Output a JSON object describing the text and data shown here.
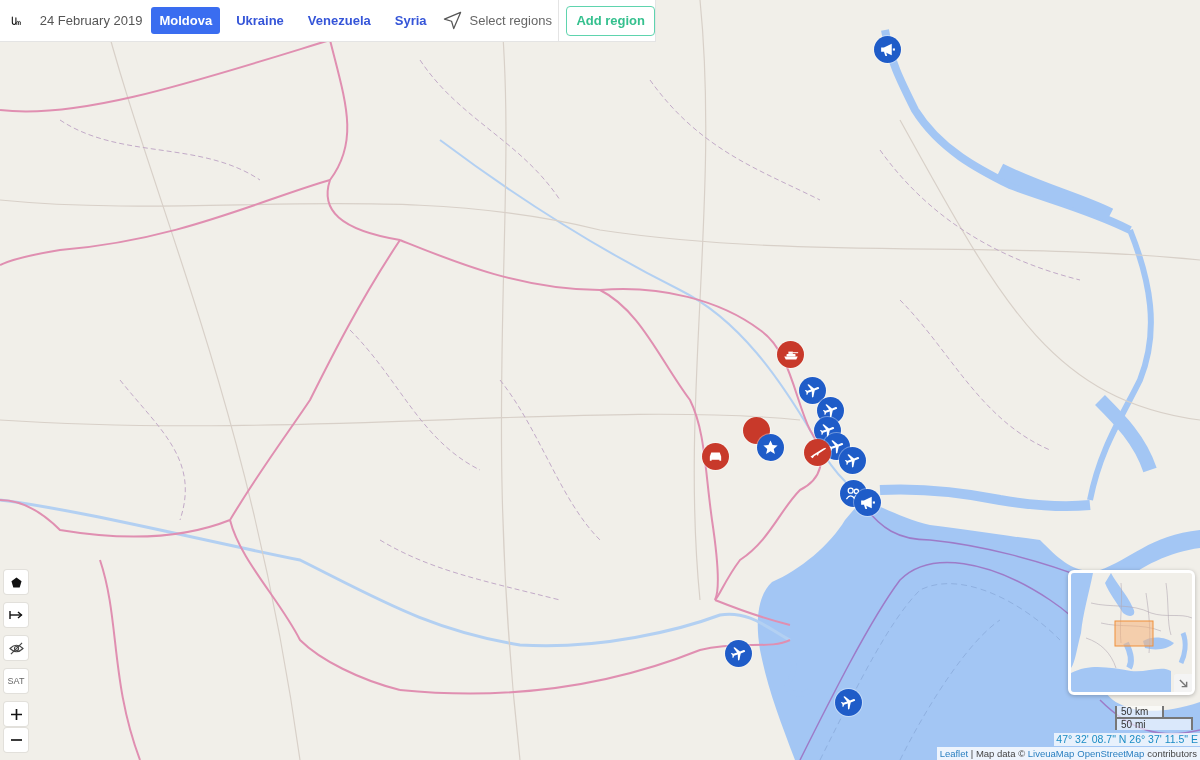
{
  "top_bar": {
    "date": "24 February 2019",
    "tabs": [
      {
        "label": "Moldova",
        "selected": true
      },
      {
        "label": "Ukraine",
        "selected": false
      },
      {
        "label": "Venezuela",
        "selected": false
      },
      {
        "label": "Syria",
        "selected": false
      }
    ],
    "select_regions": "Select regions",
    "add_region_button": "Add region"
  },
  "map_controls": {
    "layer_button": "SAT"
  },
  "markers": [
    {
      "kind": "megaphone",
      "color": "#1f5cc8"
    },
    {
      "kind": "tank",
      "color": "#c8392a"
    },
    {
      "kind": "plane",
      "color": "#1f5cc8"
    },
    {
      "kind": "plane",
      "color": "#1f5cc8"
    },
    {
      "kind": "plain",
      "color": "#c8392a"
    },
    {
      "kind": "plane",
      "color": "#1f5cc8"
    },
    {
      "kind": "plane",
      "color": "#1f5cc8"
    },
    {
      "kind": "star",
      "color": "#1f5cc8"
    },
    {
      "kind": "rifle",
      "color": "#c8392a"
    },
    {
      "kind": "car",
      "color": "#c8392a"
    },
    {
      "kind": "plane",
      "color": "#1f5cc8"
    },
    {
      "kind": "people",
      "color": "#1f5cc8"
    },
    {
      "kind": "megaphone",
      "color": "#1f5cc8"
    },
    {
      "kind": "plane",
      "color": "#1f5cc8"
    },
    {
      "kind": "plane",
      "color": "#1f5cc8"
    }
  ],
  "scale": {
    "metric": "50 km",
    "imperial": "50 mi"
  },
  "coordinates": "47° 32' 08.7\" N 26° 37' 11.5\" E",
  "attribution": {
    "leaflet_link": "Leaflet",
    "separator": "|",
    "text": "Map data ©",
    "links": [
      "LiveuaMap",
      "OpenStreetMap"
    ],
    "suffix": "contributors"
  }
}
